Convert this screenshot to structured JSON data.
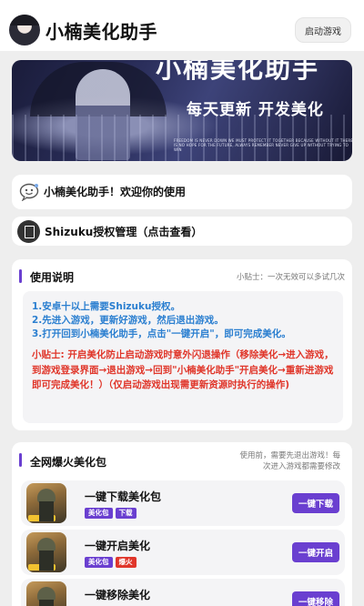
{
  "app": {
    "title": "小楠美化助手",
    "launch_button": "启动游戏"
  },
  "banner": {
    "title": "小楠美化助手",
    "slogan": "每天更新 开发美化",
    "fine_print": "FREEDOM IS NEVER DOWN WE MUST PROTECT IT TOGETHER BECAUSE WITHOUT IT THERE IS NO HOPE FOR THE FUTURE, ALWAYS REMEMBER NEVER GIVE UP WITHOUT TRYING TO WIN"
  },
  "welcome": {
    "text": "小楠美化助手！欢迎你的使用",
    "icon": "smile-bubble-icon"
  },
  "shizuku": {
    "text": "Shizuku授权管理（点击查看）",
    "icon": "clipboard-icon"
  },
  "usage": {
    "title": "使用说明",
    "tip": "小贴士：一次无效可以多试几次",
    "steps": [
      "1.安卓十以上需要Shizuku授权。",
      "2.先进入游戏，更新好游戏，然后退出游戏。",
      "3.打开回到小楠美化助手，点击\"一键开启\"，即可完成美化。"
    ],
    "warning": "小贴士: 开启美化防止启动游戏时意外闪退操作（移除美化→进入游戏，到游戏登录界面→退出游戏→回到\"小楠美化助手\"开启美化→重新进游戏即可完成美化！）（仅启动游戏出现需更新资源时执行的操作)"
  },
  "packages": {
    "title": "全网爆火美化包",
    "note": "使用前，需要先退出游戏！每次进入游戏都需要修改",
    "items": [
      {
        "name": "一键下载美化包",
        "badges": [
          "美化包",
          "下载"
        ],
        "action": "一键下载"
      },
      {
        "name": "一键开启美化",
        "badges": [
          "美化包",
          "爆火"
        ],
        "action": "一键开启"
      },
      {
        "name": "一键移除美化",
        "badges": [],
        "action": "一键移除"
      }
    ]
  },
  "colors": {
    "accent": "#6a3fd0",
    "steps_text": "#2b7fd0",
    "warning_text": "#e0362a"
  }
}
